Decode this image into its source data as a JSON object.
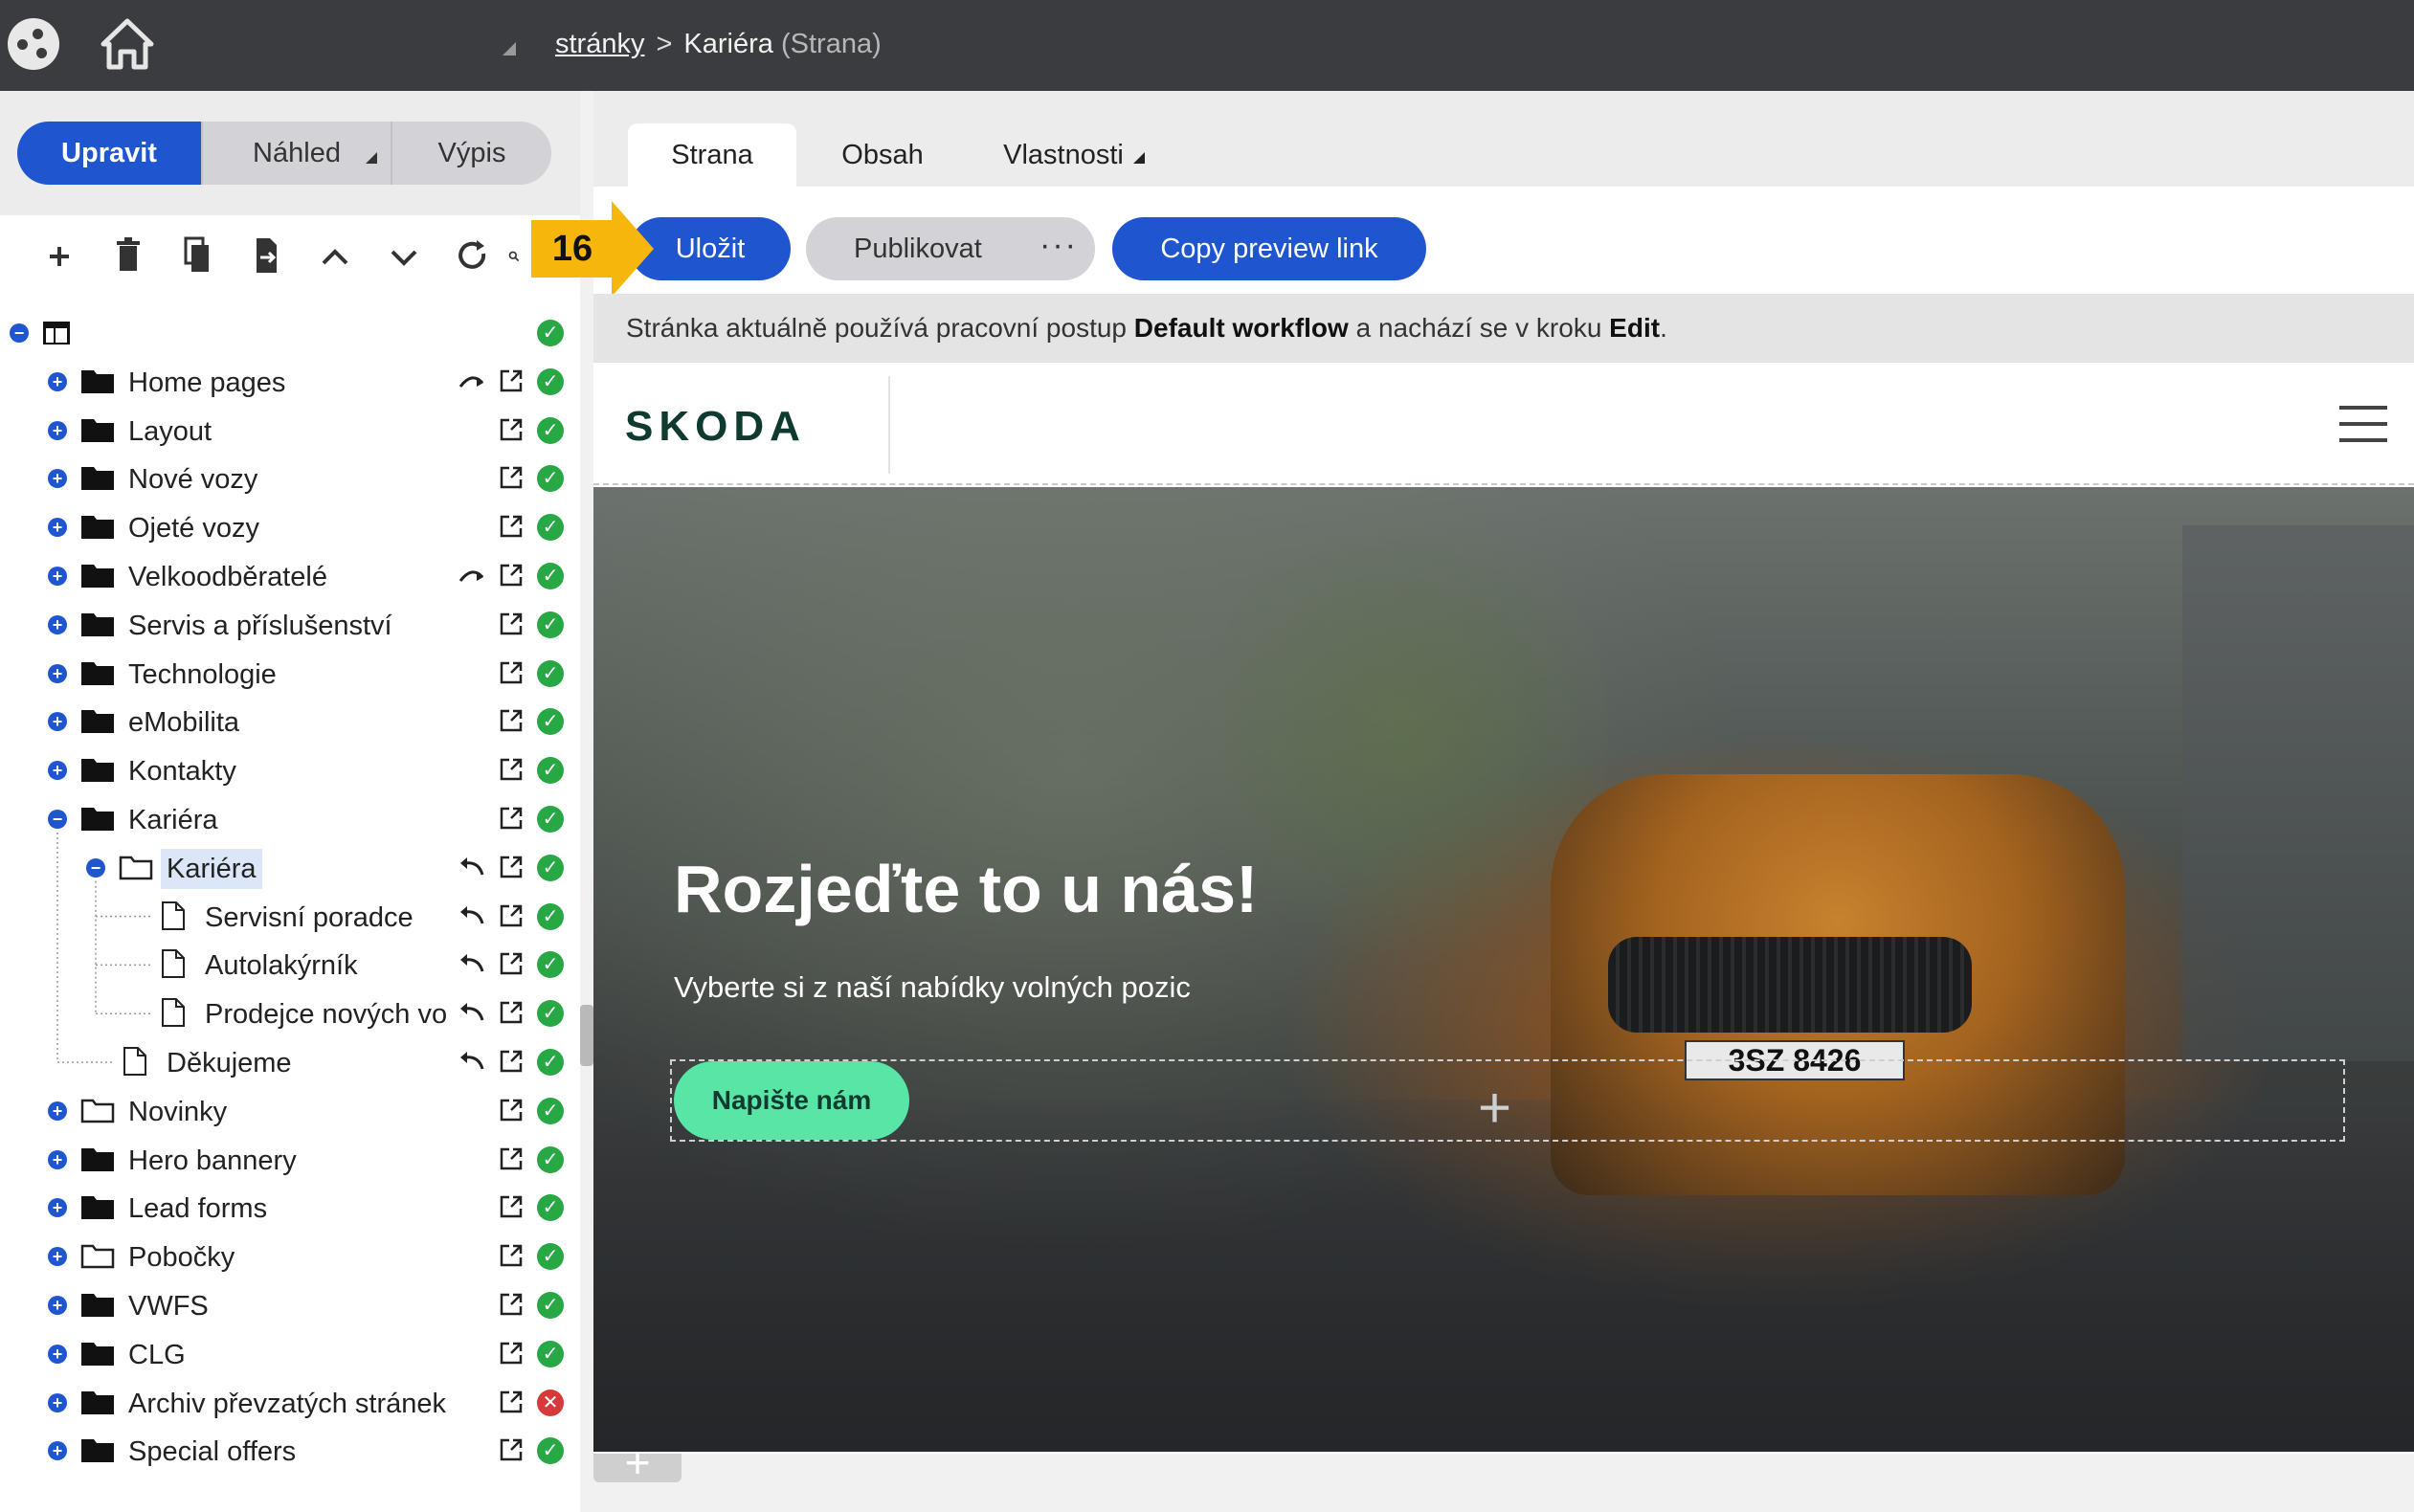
{
  "header": {
    "breadcrumb_link": "stránky",
    "breadcrumb_sep": ">",
    "breadcrumb_current": "Kariéra",
    "breadcrumb_type": "(Strana)"
  },
  "mode_switch": {
    "edit": "Upravit",
    "preview": "Náhled",
    "list": "Výpis"
  },
  "toolbar_icons": [
    "plus-icon",
    "trash-icon",
    "copy-icon",
    "export-icon",
    "chevron-up-icon",
    "chevron-down-icon",
    "refresh-icon",
    "search-icon"
  ],
  "tree": [
    {
      "label": "",
      "level": 0,
      "type": "root",
      "status": "ok"
    },
    {
      "label": "Home pages",
      "level": 1,
      "type": "folder",
      "redirect": true,
      "status": "ok"
    },
    {
      "label": "Layout",
      "level": 1,
      "type": "folder",
      "status": "ok"
    },
    {
      "label": "Nové vozy",
      "level": 1,
      "type": "folder",
      "status": "ok"
    },
    {
      "label": "Ojeté vozy",
      "level": 1,
      "type": "folder",
      "status": "ok"
    },
    {
      "label": "Velkoodběratelé",
      "level": 1,
      "type": "folder",
      "redirect": true,
      "status": "ok"
    },
    {
      "label": "Servis a příslušenství",
      "level": 1,
      "type": "folder",
      "status": "ok"
    },
    {
      "label": "Technologie",
      "level": 1,
      "type": "folder",
      "status": "ok"
    },
    {
      "label": "eMobilita",
      "level": 1,
      "type": "folder",
      "status": "ok"
    },
    {
      "label": "Kontakty",
      "level": 1,
      "type": "folder",
      "status": "ok"
    },
    {
      "label": "Kariéra",
      "level": 1,
      "type": "folder",
      "expanded": true,
      "status": "ok"
    },
    {
      "label": "Kariéra",
      "level": 2,
      "type": "folder-open",
      "selected": true,
      "undo": true,
      "status": "ok"
    },
    {
      "label": "Servisní poradce",
      "level": 3,
      "type": "file",
      "undo": true,
      "status": "ok"
    },
    {
      "label": "Autolakýrník",
      "level": 3,
      "type": "file",
      "undo": true,
      "status": "ok"
    },
    {
      "label": "Prodejce nových voz",
      "level": 3,
      "type": "file",
      "undo": true,
      "status": "ok"
    },
    {
      "label": "Děkujeme",
      "level": 2,
      "type": "file",
      "undo": true,
      "status": "ok"
    },
    {
      "label": "Novinky",
      "level": 1,
      "type": "folder-open",
      "status": "ok"
    },
    {
      "label": "Hero bannery",
      "level": 1,
      "type": "folder",
      "status": "ok"
    },
    {
      "label": "Lead forms",
      "level": 1,
      "type": "folder",
      "status": "ok"
    },
    {
      "label": "Pobočky",
      "level": 1,
      "type": "folder-open",
      "status": "ok"
    },
    {
      "label": "VWFS",
      "level": 1,
      "type": "folder",
      "status": "ok"
    },
    {
      "label": "CLG",
      "level": 1,
      "type": "folder",
      "status": "ok"
    },
    {
      "label": "Archiv převzatých stránek",
      "level": 1,
      "type": "folder",
      "status": "error"
    },
    {
      "label": "Special offers",
      "level": 1,
      "type": "folder",
      "status": "ok"
    }
  ],
  "tabs": {
    "page": "Strana",
    "content": "Obsah",
    "properties": "Vlastnosti"
  },
  "actions": {
    "save": "Uložit",
    "publish": "Publikovat",
    "more": "···",
    "copy_preview": "Copy preview link"
  },
  "marker": {
    "step": "16",
    "color": "#f6b60c"
  },
  "workflow_info": {
    "prefix": "Stránka aktuálně používá pracovní postup ",
    "workflow": "Default workflow",
    "middle": " a nachází se v kroku ",
    "step": "Edit",
    "suffix": "."
  },
  "preview": {
    "brand": "SKODA",
    "hero_title": "Rozjeďte to u nás!",
    "hero_subtitle": "Vyberte si z naší nabídky volných pozic",
    "cta": "Napište nám",
    "plate": "3SZ 8426",
    "add": "+"
  },
  "colors": {
    "primary": "#1f56d0",
    "ok": "#28a745",
    "error": "#d63a3a",
    "cta": "#58e5a5",
    "topbar": "#3a3c40"
  }
}
